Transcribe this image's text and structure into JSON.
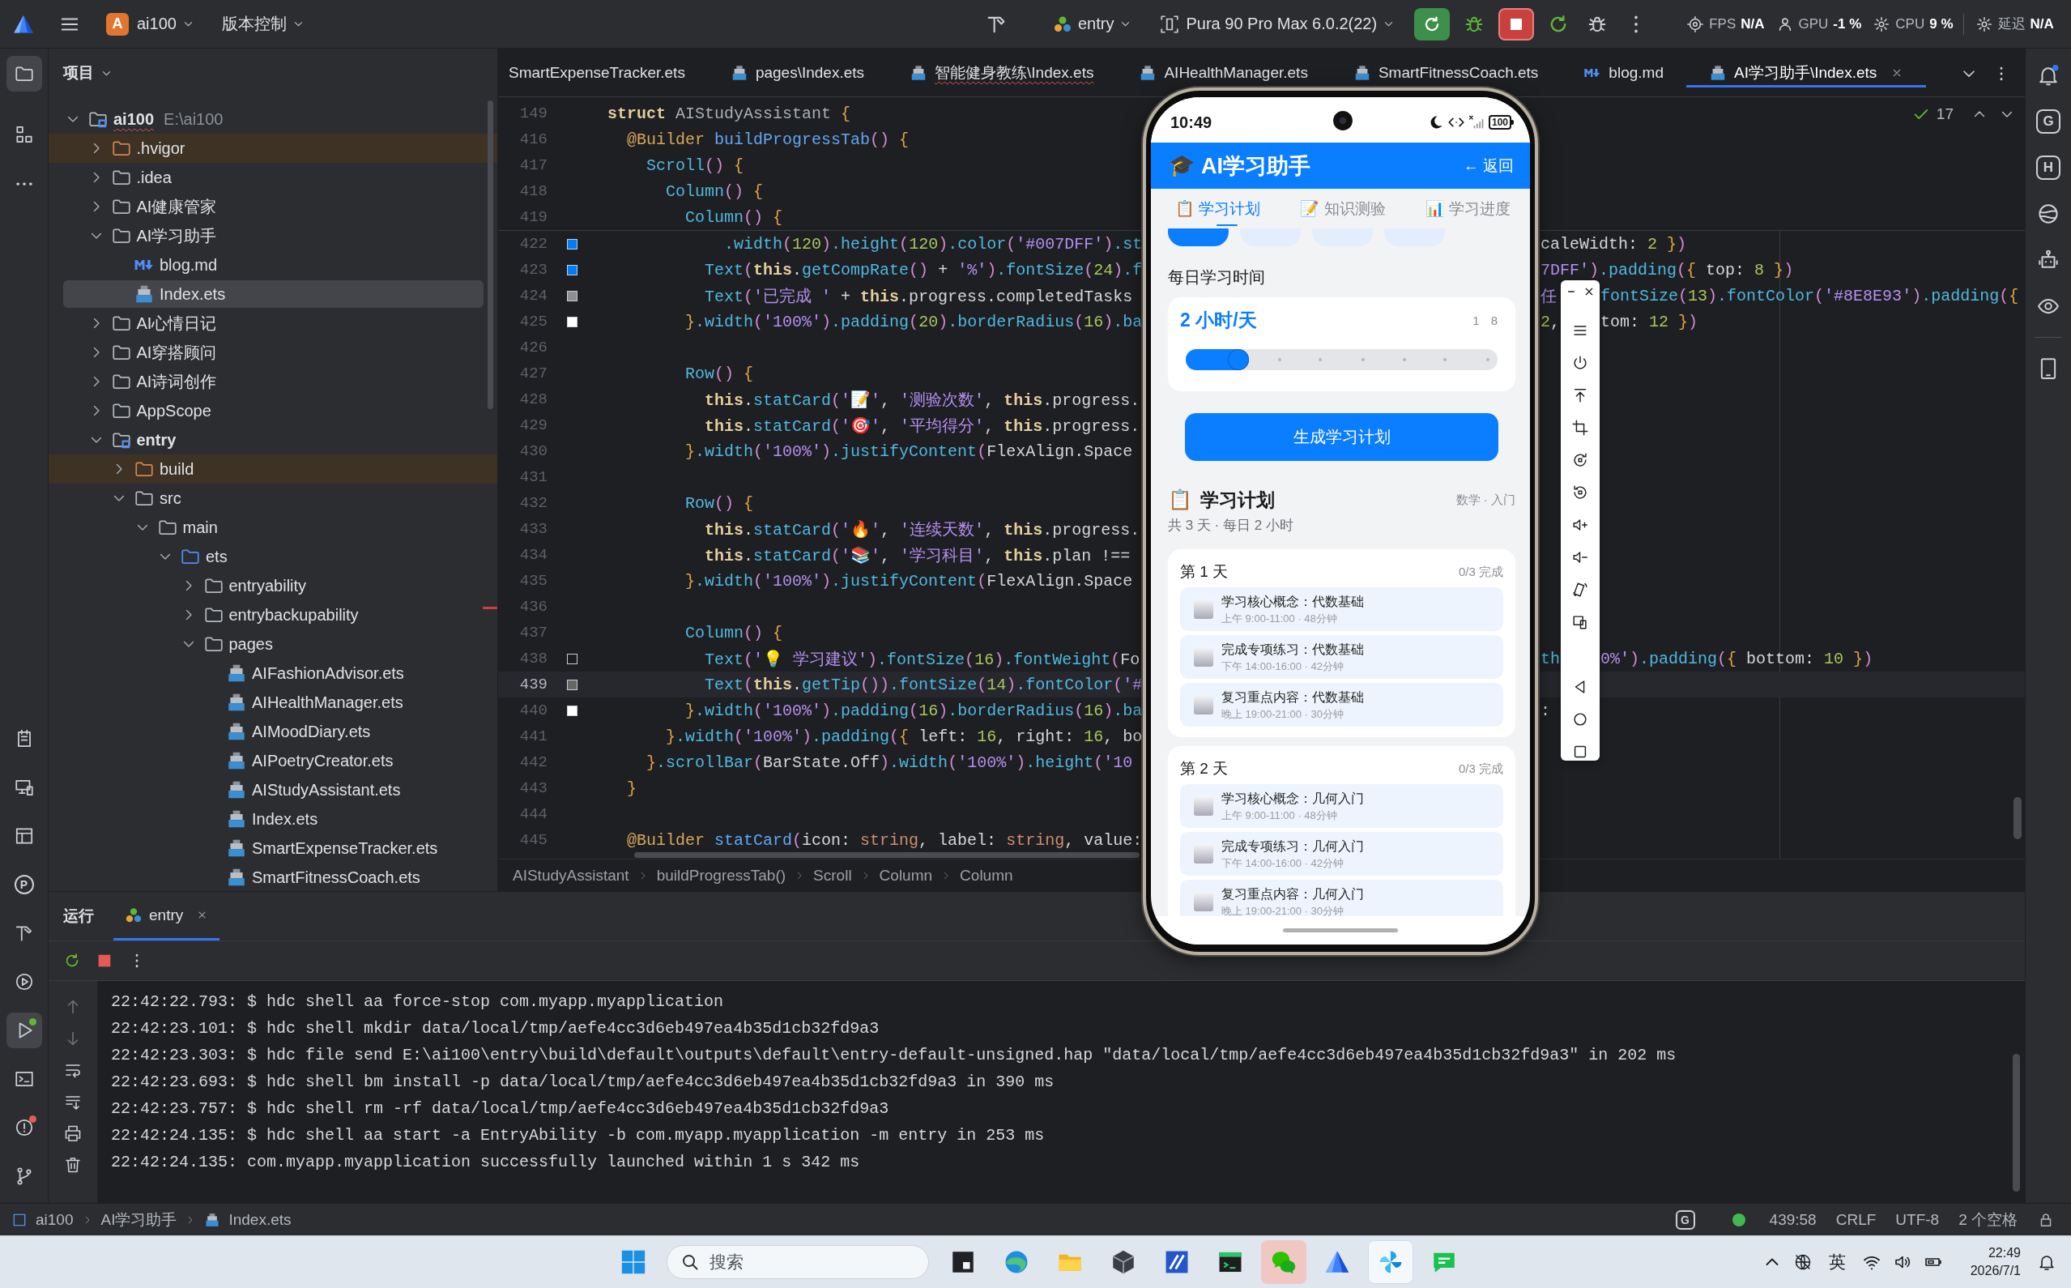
{
  "title_bar": {
    "project_badge": "A",
    "project": "ai100",
    "vcs_menu": "版本控制",
    "run_config": "entry",
    "device": "Pura 90 Pro Max 6.0.2(22)",
    "metrics": [
      {
        "label": "FPS",
        "value": "N/A"
      },
      {
        "label": "GPU",
        "value": "-1 %"
      },
      {
        "label": "CPU",
        "value": "9 %"
      },
      {
        "label": "延迟",
        "value": "N/A"
      }
    ]
  },
  "left_toolbar": {
    "top": [
      {
        "selected": true
      },
      {
        "selected": false
      },
      {
        "selected": false
      }
    ],
    "bottom": [
      {
        "selected": false
      },
      {
        "selected": false
      },
      {
        "selected": false
      },
      {
        "selected": false,
        "glyph": "P"
      },
      {
        "selected": false
      },
      {
        "selected": false
      },
      {
        "selected": true,
        "color": "#5fb832"
      },
      {
        "selected": false
      },
      {
        "selected": false,
        "color": "#e55b54"
      },
      {
        "selected": false
      }
    ]
  },
  "right_toolbar": {
    "glyphs": [
      "G",
      "H"
    ]
  },
  "project_panel": {
    "title": "项目",
    "tree": [
      {
        "name": "ai100",
        "path": "E:\\ai100",
        "kind": "module",
        "expanded": true,
        "selected": false,
        "error": true,
        "children": [
          {
            "name": ".hvigor",
            "kind": "excluded",
            "expanded": false,
            "selected": false,
            "error": false
          },
          {
            "name": ".idea",
            "kind": "folder",
            "expanded": false,
            "selected": false,
            "error": false
          },
          {
            "name": "AI健康管家",
            "kind": "folder",
            "expanded": false,
            "selected": false,
            "error": false
          },
          {
            "name": "AI学习助手",
            "kind": "folder",
            "expanded": true,
            "selected": false,
            "error": false,
            "children": [
              {
                "name": "blog.md",
                "kind": "md",
                "selected": false,
                "error": false
              },
              {
                "name": "Index.ets",
                "kind": "ets",
                "selected": true,
                "error": false
              }
            ]
          },
          {
            "name": "AI心情日记",
            "kind": "folder",
            "expanded": false,
            "selected": false,
            "error": false
          },
          {
            "name": "AI穿搭顾问",
            "kind": "folder",
            "expanded": false,
            "selected": false,
            "error": false
          },
          {
            "name": "AI诗词创作",
            "kind": "folder",
            "expanded": false,
            "selected": false,
            "error": false
          },
          {
            "name": "AppScope",
            "kind": "folder",
            "expanded": false,
            "selected": false,
            "error": false
          },
          {
            "name": "entry",
            "kind": "module",
            "expanded": true,
            "selected": false,
            "error": false,
            "children": [
              {
                "name": "build",
                "kind": "excluded",
                "expanded": false,
                "selected": false,
                "error": false
              },
              {
                "name": "src",
                "kind": "folder",
                "expanded": true,
                "selected": false,
                "error": false,
                "children": [
                  {
                    "name": "main",
                    "kind": "folder",
                    "expanded": true,
                    "selected": false,
                    "error": false,
                    "children": [
                      {
                        "name": "ets",
                        "kind": "source",
                        "expanded": true,
                        "selected": false,
                        "error": false,
                        "children": [
                          {
                            "name": "entryability",
                            "kind": "folder",
                            "expanded": false,
                            "selected": false,
                            "error": false
                          },
                          {
                            "name": "entrybackupability",
                            "kind": "folder",
                            "expanded": false,
                            "selected": false,
                            "error": false
                          },
                          {
                            "name": "pages",
                            "kind": "folder",
                            "expanded": true,
                            "selected": false,
                            "error": false,
                            "children": [
                              {
                                "name": "AIFashionAdvisor.ets",
                                "kind": "ets",
                                "selected": false,
                                "error": false
                              },
                              {
                                "name": "AIHealthManager.ets",
                                "kind": "ets",
                                "selected": false,
                                "error": false
                              },
                              {
                                "name": "AIMoodDiary.ets",
                                "kind": "ets",
                                "selected": false,
                                "error": false
                              },
                              {
                                "name": "AIPoetryCreator.ets",
                                "kind": "ets",
                                "selected": false,
                                "error": false
                              },
                              {
                                "name": "AIStudyAssistant.ets",
                                "kind": "ets",
                                "selected": false,
                                "error": false
                              },
                              {
                                "name": "Index.ets",
                                "kind": "ets",
                                "selected": false,
                                "error": false
                              },
                              {
                                "name": "SmartExpenseTracker.ets",
                                "kind": "ets",
                                "selected": false,
                                "error": false
                              },
                              {
                                "name": "SmartFitnessCoach.ets",
                                "kind": "ets",
                                "selected": false,
                                "error": false
                              }
                            ]
                          }
                        ]
                      }
                    ]
                  }
                ]
              }
            ]
          }
        ]
      }
    ]
  },
  "editor": {
    "tabs": [
      {
        "label": "SmartExpenseTracker.ets",
        "kind": "plain",
        "selected": false,
        "error": false
      },
      {
        "label": "pages\\Index.ets",
        "kind": "ets",
        "selected": false,
        "error": false
      },
      {
        "label": "智能健身教练\\Index.ets",
        "kind": "ets",
        "selected": false,
        "error": true
      },
      {
        "label": "AIHealthManager.ets",
        "kind": "ets",
        "selected": false,
        "error": false
      },
      {
        "label": "SmartFitnessCoach.ets",
        "kind": "ets",
        "selected": false,
        "error": false
      },
      {
        "label": "blog.md",
        "kind": "md",
        "selected": false,
        "error": false
      },
      {
        "label": "AI学习助手\\Index.ets",
        "kind": "ets",
        "selected": true,
        "error": false
      }
    ],
    "inspections": "17",
    "sticky_lines": [
      {
        "number": "149",
        "tokens": [
          {
            "kind": "keyword",
            "text": "struct "
          },
          {
            "kind": "type",
            "text": "AIStudyAssistant "
          },
          {
            "kind": "brace",
            "text": "{"
          }
        ]
      },
      {
        "number": "416",
        "tokens": [
          {
            "kind": "annotation",
            "text": "  @Builder "
          },
          {
            "kind": "decl",
            "text": "buildProgressTab"
          },
          {
            "kind": "paren",
            "text": "()"
          },
          {
            "kind": "brace",
            "text": " {"
          }
        ]
      },
      {
        "number": "417",
        "tokens": [
          {
            "kind": "call",
            "text": "    Scroll"
          },
          {
            "kind": "paren",
            "text": "()"
          },
          {
            "kind": "brace",
            "text": " {"
          }
        ]
      },
      {
        "number": "418",
        "tokens": [
          {
            "kind": "call",
            "text": "      Column"
          },
          {
            "kind": "paren",
            "text": "()"
          },
          {
            "kind": "brace",
            "text": " {"
          }
        ]
      },
      {
        "number": "419",
        "tokens": [
          {
            "kind": "call",
            "text": "        Column"
          },
          {
            "kind": "paren",
            "text": "()"
          },
          {
            "kind": "brace",
            "text": " {"
          }
        ]
      }
    ],
    "lines": [
      {
        "number": "422",
        "current": false,
        "color": "#007dff",
        "tokens": [
          {
            "kind": "call",
            "text": "            .width"
          },
          {
            "kind": "paren",
            "text": "("
          },
          {
            "kind": "number",
            "text": "120"
          },
          {
            "kind": "paren",
            "text": ")"
          },
          {
            "kind": "call",
            "text": ".height"
          },
          {
            "kind": "paren",
            "text": "("
          },
          {
            "kind": "number",
            "text": "120"
          },
          {
            "kind": "paren",
            "text": ")"
          },
          {
            "kind": "call",
            "text": ".color"
          },
          {
            "kind": "paren",
            "text": "("
          },
          {
            "kind": "string",
            "text": "'#007DFF'"
          },
          {
            "kind": "paren",
            "text": ")"
          },
          {
            "kind": "call",
            "text": ".st"
          }
        ],
        "right": [
          [
            {
              "kind": "plain",
              "text": "caleWidth: "
            },
            {
              "kind": "number",
              "text": "2"
            },
            {
              "kind": "brace",
              "text": " }"
            },
            {
              "kind": "paren",
              "text": ")"
            }
          ]
        ]
      },
      {
        "number": "423",
        "current": false,
        "color": "#007dff",
        "tokens": [
          {
            "kind": "call",
            "text": "          Text"
          },
          {
            "kind": "paren",
            "text": "("
          },
          {
            "kind": "keyword",
            "text": "this"
          },
          {
            "kind": "plain",
            "text": "."
          },
          {
            "kind": "call",
            "text": "getCompRate"
          },
          {
            "kind": "paren",
            "text": "()"
          },
          {
            "kind": "plain",
            "text": " + "
          },
          {
            "kind": "string",
            "text": "'%'"
          },
          {
            "kind": "paren",
            "text": ")"
          },
          {
            "kind": "call",
            "text": ".fontSize"
          },
          {
            "kind": "paren",
            "text": "("
          },
          {
            "kind": "number",
            "text": "24"
          },
          {
            "kind": "paren",
            "text": ")"
          },
          {
            "kind": "call",
            "text": ".f"
          }
        ],
        "right": [
          [
            {
              "kind": "string",
              "text": "7DFF'"
            },
            {
              "kind": "paren",
              "text": ")"
            },
            {
              "kind": "call",
              "text": ".padding"
            },
            {
              "kind": "paren",
              "text": "("
            },
            {
              "kind": "brace",
              "text": "{ "
            },
            {
              "kind": "plain",
              "text": "top: "
            },
            {
              "kind": "number",
              "text": "8"
            },
            {
              "kind": "brace",
              "text": " }"
            },
            {
              "kind": "paren",
              "text": ")"
            }
          ]
        ]
      },
      {
        "number": "424",
        "current": false,
        "color": "#8e8e93",
        "tokens": [
          {
            "kind": "call",
            "text": "          Text"
          },
          {
            "kind": "paren",
            "text": "("
          },
          {
            "kind": "string",
            "text": "'已完成 '"
          },
          {
            "kind": "plain",
            "text": " + "
          },
          {
            "kind": "keyword",
            "text": "this"
          },
          {
            "kind": "plain",
            "text": ".progress.completedTasks"
          }
        ],
        "right": [
          [
            {
              "kind": "string",
              "text": "任"
            }
          ],
          [
            {
              "kind": "call",
              "text": "fontSize"
            },
            {
              "kind": "paren",
              "text": "("
            },
            {
              "kind": "number",
              "text": "13"
            },
            {
              "kind": "paren",
              "text": ")"
            },
            {
              "kind": "call",
              "text": ".fontColor"
            },
            {
              "kind": "paren",
              "text": "("
            },
            {
              "kind": "string",
              "text": "'#8E8E93'"
            },
            {
              "kind": "paren",
              "text": ")"
            },
            {
              "kind": "call",
              "text": ".padding"
            },
            {
              "kind": "paren",
              "text": "("
            },
            {
              "kind": "brace",
              "text": "{"
            }
          ]
        ]
      },
      {
        "number": "425",
        "current": false,
        "color": "#ffffff",
        "tokens": [
          {
            "kind": "brace",
            "text": "        }"
          },
          {
            "kind": "call",
            "text": ".width"
          },
          {
            "kind": "paren",
            "text": "("
          },
          {
            "kind": "string",
            "text": "'100%'"
          },
          {
            "kind": "paren",
            "text": ")"
          },
          {
            "kind": "call",
            "text": ".padding"
          },
          {
            "kind": "paren",
            "text": "("
          },
          {
            "kind": "number",
            "text": "20"
          },
          {
            "kind": "paren",
            "text": ")"
          },
          {
            "kind": "call",
            "text": ".borderRadius"
          },
          {
            "kind": "paren",
            "text": "("
          },
          {
            "kind": "number",
            "text": "16"
          },
          {
            "kind": "paren",
            "text": ")"
          },
          {
            "kind": "call",
            "text": ".ba"
          }
        ],
        "right": [
          [
            {
              "kind": "number",
              "text": "2"
            },
            {
              "kind": "plain",
              "text": ","
            }
          ],
          [
            {
              "kind": "plain",
              "text": "tom: "
            },
            {
              "kind": "number",
              "text": "12"
            },
            {
              "kind": "brace",
              "text": " }"
            },
            {
              "kind": "paren",
              "text": ")"
            }
          ]
        ]
      },
      {
        "number": "426",
        "current": false
      },
      {
        "number": "427",
        "current": false,
        "tokens": [
          {
            "kind": "call",
            "text": "        Row"
          },
          {
            "kind": "paren",
            "text": "()"
          },
          {
            "kind": "brace",
            "text": " {"
          }
        ]
      },
      {
        "number": "428",
        "current": false,
        "tokens": [
          {
            "kind": "keyword",
            "text": "          this"
          },
          {
            "kind": "plain",
            "text": "."
          },
          {
            "kind": "call",
            "text": "statCard"
          },
          {
            "kind": "paren",
            "text": "("
          },
          {
            "kind": "string",
            "text": "'📝'"
          },
          {
            "kind": "plain",
            "text": ", "
          },
          {
            "kind": "string",
            "text": "'测验次数'"
          },
          {
            "kind": "plain",
            "text": ", "
          },
          {
            "kind": "keyword",
            "text": "this"
          },
          {
            "kind": "plain",
            "text": ".progress."
          }
        ]
      },
      {
        "number": "429",
        "current": false,
        "tokens": [
          {
            "kind": "keyword",
            "text": "          this"
          },
          {
            "kind": "plain",
            "text": "."
          },
          {
            "kind": "call",
            "text": "statCard"
          },
          {
            "kind": "paren",
            "text": "("
          },
          {
            "kind": "string",
            "text": "'🎯'"
          },
          {
            "kind": "plain",
            "text": ", "
          },
          {
            "kind": "string",
            "text": "'平均得分'"
          },
          {
            "kind": "plain",
            "text": ", "
          },
          {
            "kind": "keyword",
            "text": "this"
          },
          {
            "kind": "plain",
            "text": ".progress."
          }
        ]
      },
      {
        "number": "430",
        "current": false,
        "tokens": [
          {
            "kind": "brace",
            "text": "        }"
          },
          {
            "kind": "call",
            "text": ".width"
          },
          {
            "kind": "paren",
            "text": "("
          },
          {
            "kind": "string",
            "text": "'100%'"
          },
          {
            "kind": "paren",
            "text": ")"
          },
          {
            "kind": "call",
            "text": ".justifyContent"
          },
          {
            "kind": "paren",
            "text": "("
          },
          {
            "kind": "plain",
            "text": "FlexAlign.Space"
          }
        ]
      },
      {
        "number": "431",
        "current": false
      },
      {
        "number": "432",
        "current": false,
        "tokens": [
          {
            "kind": "call",
            "text": "        Row"
          },
          {
            "kind": "paren",
            "text": "()"
          },
          {
            "kind": "brace",
            "text": " {"
          }
        ]
      },
      {
        "number": "433",
        "current": false,
        "tokens": [
          {
            "kind": "keyword",
            "text": "          this"
          },
          {
            "kind": "plain",
            "text": "."
          },
          {
            "kind": "call",
            "text": "statCard"
          },
          {
            "kind": "paren",
            "text": "("
          },
          {
            "kind": "string",
            "text": "'🔥'"
          },
          {
            "kind": "plain",
            "text": ", "
          },
          {
            "kind": "string",
            "text": "'连续天数'"
          },
          {
            "kind": "plain",
            "text": ", "
          },
          {
            "kind": "keyword",
            "text": "this"
          },
          {
            "kind": "plain",
            "text": ".progress."
          }
        ]
      },
      {
        "number": "434",
        "current": false,
        "tokens": [
          {
            "kind": "keyword",
            "text": "          this"
          },
          {
            "kind": "plain",
            "text": "."
          },
          {
            "kind": "call",
            "text": "statCard"
          },
          {
            "kind": "paren",
            "text": "("
          },
          {
            "kind": "string",
            "text": "'📚'"
          },
          {
            "kind": "plain",
            "text": ", "
          },
          {
            "kind": "string",
            "text": "'学习科目'"
          },
          {
            "kind": "plain",
            "text": ", "
          },
          {
            "kind": "keyword",
            "text": "this"
          },
          {
            "kind": "plain",
            "text": ".plan !=="
          }
        ]
      },
      {
        "number": "435",
        "current": false,
        "tokens": [
          {
            "kind": "brace",
            "text": "        }"
          },
          {
            "kind": "call",
            "text": ".width"
          },
          {
            "kind": "paren",
            "text": "("
          },
          {
            "kind": "string",
            "text": "'100%'"
          },
          {
            "kind": "paren",
            "text": ")"
          },
          {
            "kind": "call",
            "text": ".justifyContent"
          },
          {
            "kind": "paren",
            "text": "("
          },
          {
            "kind": "plain",
            "text": "FlexAlign.Space"
          }
        ]
      },
      {
        "number": "436",
        "current": false
      },
      {
        "number": "437",
        "current": false,
        "tokens": [
          {
            "kind": "call",
            "text": "        Column"
          },
          {
            "kind": "paren",
            "text": "()"
          },
          {
            "kind": "brace",
            "text": " {"
          }
        ]
      },
      {
        "number": "438",
        "current": false,
        "color": "#1c1c1e",
        "tokens": [
          {
            "kind": "call",
            "text": "          Text"
          },
          {
            "kind": "paren",
            "text": "("
          },
          {
            "kind": "string",
            "text": "'💡 学习建议'"
          },
          {
            "kind": "paren",
            "text": ")"
          },
          {
            "kind": "call",
            "text": ".fontSize"
          },
          {
            "kind": "paren",
            "text": "("
          },
          {
            "kind": "number",
            "text": "16"
          },
          {
            "kind": "paren",
            "text": ")"
          },
          {
            "kind": "call",
            "text": ".fontWeight"
          },
          {
            "kind": "paren",
            "text": "("
          },
          {
            "kind": "plain",
            "text": "Fo"
          }
        ],
        "right": [
          [
            {
              "kind": "call",
              "text": "th"
            }
          ],
          [
            {
              "kind": "string",
              "text": "0%'"
            },
            {
              "kind": "paren",
              "text": ")"
            },
            {
              "kind": "call",
              "text": ".padding"
            },
            {
              "kind": "paren",
              "text": "("
            },
            {
              "kind": "brace",
              "text": "{ "
            },
            {
              "kind": "plain",
              "text": "bottom: "
            },
            {
              "kind": "number",
              "text": "10"
            },
            {
              "kind": "brace",
              "text": " }"
            },
            {
              "kind": "paren",
              "text": ")"
            }
          ]
        ]
      },
      {
        "number": "439",
        "current": true,
        "color": "#666666",
        "tokens": [
          {
            "kind": "call",
            "text": "          Text"
          },
          {
            "kind": "paren",
            "text": "("
          },
          {
            "kind": "keyword",
            "text": "this"
          },
          {
            "kind": "plain",
            "text": "."
          },
          {
            "kind": "call",
            "text": "getTip"
          },
          {
            "kind": "paren",
            "text": "())"
          },
          {
            "kind": "call",
            "text": ".fontSize"
          },
          {
            "kind": "paren",
            "text": "("
          },
          {
            "kind": "number",
            "text": "14"
          },
          {
            "kind": "paren",
            "text": ")"
          },
          {
            "kind": "call",
            "text": ".fontColor"
          },
          {
            "kind": "paren",
            "text": "("
          },
          {
            "kind": "string",
            "text": "'#"
          }
        ]
      },
      {
        "number": "440",
        "current": false,
        "color": "#ffffff",
        "tokens": [
          {
            "kind": "brace",
            "text": "        }"
          },
          {
            "kind": "call",
            "text": ".width"
          },
          {
            "kind": "paren",
            "text": "("
          },
          {
            "kind": "string",
            "text": "'100%'"
          },
          {
            "kind": "paren",
            "text": ")"
          },
          {
            "kind": "call",
            "text": ".padding"
          },
          {
            "kind": "paren",
            "text": "("
          },
          {
            "kind": "number",
            "text": "16"
          },
          {
            "kind": "paren",
            "text": ")"
          },
          {
            "kind": "call",
            "text": ".borderRadius"
          },
          {
            "kind": "paren",
            "text": "("
          },
          {
            "kind": "number",
            "text": "16"
          },
          {
            "kind": "paren",
            "text": ")"
          },
          {
            "kind": "call",
            "text": ".ba"
          }
        ],
        "right": [
          [
            {
              "kind": "plain",
              "text": ":"
            }
          ]
        ]
      },
      {
        "number": "441",
        "current": false,
        "tokens": [
          {
            "kind": "brace",
            "text": "      }"
          },
          {
            "kind": "call",
            "text": ".width"
          },
          {
            "kind": "paren",
            "text": "("
          },
          {
            "kind": "string",
            "text": "'100%'"
          },
          {
            "kind": "paren",
            "text": ")"
          },
          {
            "kind": "call",
            "text": ".padding"
          },
          {
            "kind": "paren",
            "text": "("
          },
          {
            "kind": "brace",
            "text": "{ "
          },
          {
            "kind": "plain",
            "text": "left: "
          },
          {
            "kind": "number",
            "text": "16"
          },
          {
            "kind": "plain",
            "text": ", right: "
          },
          {
            "kind": "number",
            "text": "16"
          },
          {
            "kind": "plain",
            "text": ", bo"
          }
        ]
      },
      {
        "number": "442",
        "current": false,
        "tokens": [
          {
            "kind": "brace",
            "text": "    }"
          },
          {
            "kind": "call",
            "text": ".scrollBar"
          },
          {
            "kind": "paren",
            "text": "("
          },
          {
            "kind": "plain",
            "text": "BarState.Off"
          },
          {
            "kind": "paren",
            "text": ")"
          },
          {
            "kind": "call",
            "text": ".width"
          },
          {
            "kind": "paren",
            "text": "("
          },
          {
            "kind": "string",
            "text": "'100%'"
          },
          {
            "kind": "paren",
            "text": ")"
          },
          {
            "kind": "call",
            "text": ".height"
          },
          {
            "kind": "paren",
            "text": "("
          },
          {
            "kind": "string",
            "text": "'10"
          }
        ]
      },
      {
        "number": "443",
        "current": false,
        "tokens": [
          {
            "kind": "brace",
            "text": "  }"
          }
        ]
      },
      {
        "number": "444",
        "current": false
      },
      {
        "number": "445",
        "current": false,
        "tokens": [
          {
            "kind": "annotation",
            "text": "  @Builder "
          },
          {
            "kind": "decl",
            "text": "statCard"
          },
          {
            "kind": "paren",
            "text": "("
          },
          {
            "kind": "plain",
            "text": "icon: "
          },
          {
            "kind": "typename",
            "text": "string"
          },
          {
            "kind": "plain",
            "text": ", label: "
          },
          {
            "kind": "typename",
            "text": "string"
          },
          {
            "kind": "plain",
            "text": ", value:"
          }
        ]
      }
    ],
    "breadcrumb": [
      "AIStudyAssistant",
      "buildProgressTab()",
      "Scroll",
      "Column",
      "Column"
    ]
  },
  "emulator": {
    "time": "10:49",
    "battery": "100",
    "app": {
      "title_icon": "🎓",
      "title": "AI学习助手",
      "back": "← 返回",
      "tabs": [
        {
          "icon": "📋",
          "label": "学习计划",
          "selected": true
        },
        {
          "icon": "📝",
          "label": "知识测验",
          "selected": false
        },
        {
          "icon": "📊",
          "label": "学习进度",
          "selected": false
        }
      ],
      "level_chips": [
        {
          "selected": true
        },
        {
          "selected": false
        },
        {
          "selected": false
        },
        {
          "selected": false
        }
      ],
      "daily_label": "每日学习时间",
      "daily_value": "2 小时/天",
      "slider": {
        "min": "1",
        "max": "8",
        "level": 0.17
      },
      "generate_button": "生成学习计划",
      "plan": {
        "icon": "📋",
        "title": "学习计划",
        "meta": "数学 · 入门",
        "summary": "共 3 天 · 每日 2 小时",
        "days": [
          {
            "title": "第 1 天",
            "progress": "0/3 完成",
            "tasks": [
              {
                "title": "学习核心概念：代数基础",
                "time": "上午 9:00-11:00 · 48分钟",
                "checked": false
              },
              {
                "title": "完成专项练习：代数基础",
                "time": "下午 14:00-16:00 · 42分钟",
                "checked": false
              },
              {
                "title": "复习重点内容：代数基础",
                "time": "晚上 19:00-21:00 · 30分钟",
                "checked": false
              }
            ]
          },
          {
            "title": "第 2 天",
            "progress": "0/3 完成",
            "tasks": [
              {
                "title": "学习核心概念：几何入门",
                "time": "上午 9:00-11:00 · 48分钟",
                "checked": false
              },
              {
                "title": "完成专项练习：几何入门",
                "time": "下午 14:00-16:00 · 42分钟",
                "checked": false
              },
              {
                "title": "复习重点内容：几何入门",
                "time": "晚上 19:00-21:00 · 30分钟",
                "checked": false
              }
            ]
          }
        ]
      }
    }
  },
  "run_panel": {
    "title": "运行",
    "tabs": [
      {
        "label": "entry",
        "selected": true
      }
    ],
    "lines": [
      "22:42:22.793: $ hdc shell aa force-stop com.myapp.myapplication",
      "22:42:23.101: $ hdc shell mkdir data/local/tmp/aefe4cc3d6eb497ea4b35d1cb32fd9a3",
      "22:42:23.303: $ hdc file send E:\\ai100\\entry\\build\\default\\outputs\\default\\entry-default-unsigned.hap \"data/local/tmp/aefe4cc3d6eb497ea4b35d1cb32fd9a3\" in 202 ms",
      "22:42:23.693: $ hdc shell bm install -p data/local/tmp/aefe4cc3d6eb497ea4b35d1cb32fd9a3 in 390 ms",
      "22:42:23.757: $ hdc shell rm -rf data/local/tmp/aefe4cc3d6eb497ea4b35d1cb32fd9a3",
      "22:42:24.135: $ hdc shell aa start -a EntryAbility -b com.myapp.myapplication -m entry in 253 ms",
      "22:42:24.135: com.myapp.myapplication successfully launched within 1 s 342 ms"
    ]
  },
  "status_bar": {
    "path": [
      {
        "label": "ai100",
        "kind": "module"
      },
      {
        "label": "AI学习助手",
        "kind": "plain"
      },
      {
        "label": "Index.ets",
        "kind": "ets"
      }
    ],
    "badge": "G",
    "position": "439:58",
    "line_ending": "CRLF",
    "encoding": "UTF-8",
    "indent": "2 个空格"
  },
  "taskbar": {
    "search_placeholder": "搜索",
    "apps": [
      {
        "selected": false,
        "flashing": false
      },
      {
        "selected": false,
        "flashing": false
      },
      {
        "selected": false,
        "flashing": false
      },
      {
        "selected": false,
        "flashing": false
      },
      {
        "selected": false,
        "flashing": false
      },
      {
        "selected": false,
        "flashing": false
      },
      {
        "selected": false,
        "flashing": true
      },
      {
        "selected": false,
        "flashing": false
      },
      {
        "selected": true,
        "flashing": false
      },
      {
        "selected": false,
        "flashing": false
      }
    ],
    "ime": "英",
    "time": "22:49",
    "date": "2026/7/1"
  }
}
